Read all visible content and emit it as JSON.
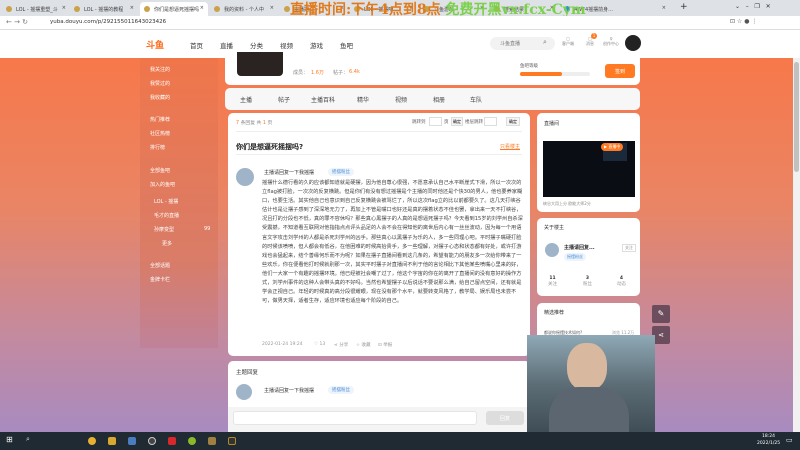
{
  "browser": {
    "tabs": [
      "LOL - 摇摆重塑_斗",
      "LOL - 摇摆的教程",
      "你们是想逼死摇摆吗",
      "我的资料 - 个人中",
      "主播摇...",
      "LOL - 摇摆吧",
      "斗鱼游戏",
      "搜索结果",
      "AWF4摇摆前身..."
    ],
    "url": "yuba.douyu.com/p/292155011643023426"
  },
  "overlay_text": {
    "part1": "直播时间:下午4点到8点",
    "part2": "免费开黑vx:fcx-Cym"
  },
  "header": {
    "logo": "斗鱼",
    "nav": [
      "首页",
      "直播",
      "分类",
      "视频",
      "游戏",
      "鱼吧"
    ],
    "search_placeholder": "斗鱼直播",
    "icons": [
      {
        "name": "客户端"
      },
      {
        "name": "消息",
        "badge": "1"
      },
      {
        "name": "创作中心"
      }
    ]
  },
  "sidebar": {
    "items": [
      "我关注的",
      "我赞过的",
      "我收藏的",
      "热门推荐",
      "社区热榜",
      "排行榜",
      "全部鱼吧",
      "加入的鱼吧",
      "LOL - 摇摆",
      "毛才的直播",
      "孙摩变型",
      "更多",
      "全部话题",
      "金牌卡栏"
    ],
    "count_badge": "99"
  },
  "profile": {
    "followers_label": "成员：",
    "followers": "1.6万",
    "posts_label": "帖子：",
    "posts": "6.4k",
    "level_label": "鱼吧等级",
    "sign_button": "签到"
  },
  "tabs": [
    "主播",
    "帖子",
    "主播百科",
    "精华",
    "视频",
    "相册",
    "车队"
  ],
  "post": {
    "reply_count": "7",
    "reply_text": "条回复 共",
    "pages": "1",
    "pages_unit": "页",
    "jump_label": "跳转到",
    "page_unit": "页",
    "confirm": "确定",
    "floor_label": "楼层跳转",
    "confirm2": "确定",
    "title": "你们是想逼死摇摆吗?",
    "only_op": "只看楼主",
    "author": "主播请回复一下我摇摆",
    "badge": "摇摆粉丝",
    "body": "摇摆什么德行看的久的应该都知道就是硬摆，因为他自尊心很强，不愿意承认自己水平断崖式下滑，所以一次次的立flag被打脸，一次次的反复横跳。但是你们有没有想过摇摆是个主播的同时他还是个快30的男人，他也要养家糊口，也要生活。其实他自己也意识到自己反复横跳会被骂烂了，所以这次flag立的比以前都要久了。这几天打峡谷估计也是让摆子感到了深深地无力了，再加上不管是嘴口也好还是真的摆着状态不佳也罢，拿出来一天不打峡谷，况且打的分段也不低，真的罪不容休吗？那些真心黑摆子的人真的是想逼死摆子吗？今天看到15岁的刘学州自杀深受震撼，不知道看互联网对他指指点点评头品足的人会不会在得知他的离世后内心有一丝丝波动，因为每一个用语言文字攻击刘学州的人都是杀死刘学州的凶手。那些真心以黑摆子为乐的人，多一些同理心吧。平时摆子嘴硬打脸的时候该喷喷，但人都会有低谷，在他困难的时候高抬贵手，多一些理解，对摆子心态和状态都有好处，或许打游戏也会猛起来，结个善缘何乐而不为呢？如果在摆子直播间看到这几条的，希望有能力的朋友多一次给你带来了一些欢乐，你在便看他打时候就别那一次，其实平时摆子对直播间不利于他的言论相比下其他某些喷嘴心里来的好，他们一大家一个有趣的摇摆环境。他已经被社会嘲了过了，他这个宇宙的你在的离开了直播间的没有意好的操作方式，刘学州事件的这种人会带头真的不好吗。当然也希望摆子以后说话不要说那么满，给自己留点空间，还有就是学会正视自己。年轻的时候真的高分段很耀眼，现在没有那个水平，就要转变风格了，教学局、娱乐局也未尝不可，做男天择，适者生存，适应环境也适应每个阶段的自己。",
    "date": "2022-01-24 19:24",
    "likes": "13",
    "share": "分享",
    "collect": "收藏",
    "report": "举报"
  },
  "replies": {
    "title": "主题回复",
    "author": "主播请回复一下我摇摆",
    "badge": "摇摆粉丝",
    "reply_button": "回复"
  },
  "right": {
    "live_title": "直播间",
    "live_badge": "直播中",
    "live_caption": "峡谷大用上分 欧能大师2分",
    "about_title": "关于楼主",
    "op_name": "主播请回复...",
    "op_badge": "摇摆粉丝",
    "follow": "关注",
    "stats": [
      {
        "value": "11",
        "label": "关注"
      },
      {
        "value": "3",
        "label": "粉丝"
      },
      {
        "value": "4",
        "label": "动态"
      }
    ],
    "rec_title": "精选推荐",
    "rec_item": "都说你摇摆技术如何?",
    "rec_views": "浏览 11.2万"
  },
  "taskbar": {
    "time": "18:24",
    "date": "2022/1/25"
  },
  "colors": {
    "accent": "#ff7a22",
    "bg_top": "#f7784a",
    "bg_bottom": "#a88bc0"
  }
}
